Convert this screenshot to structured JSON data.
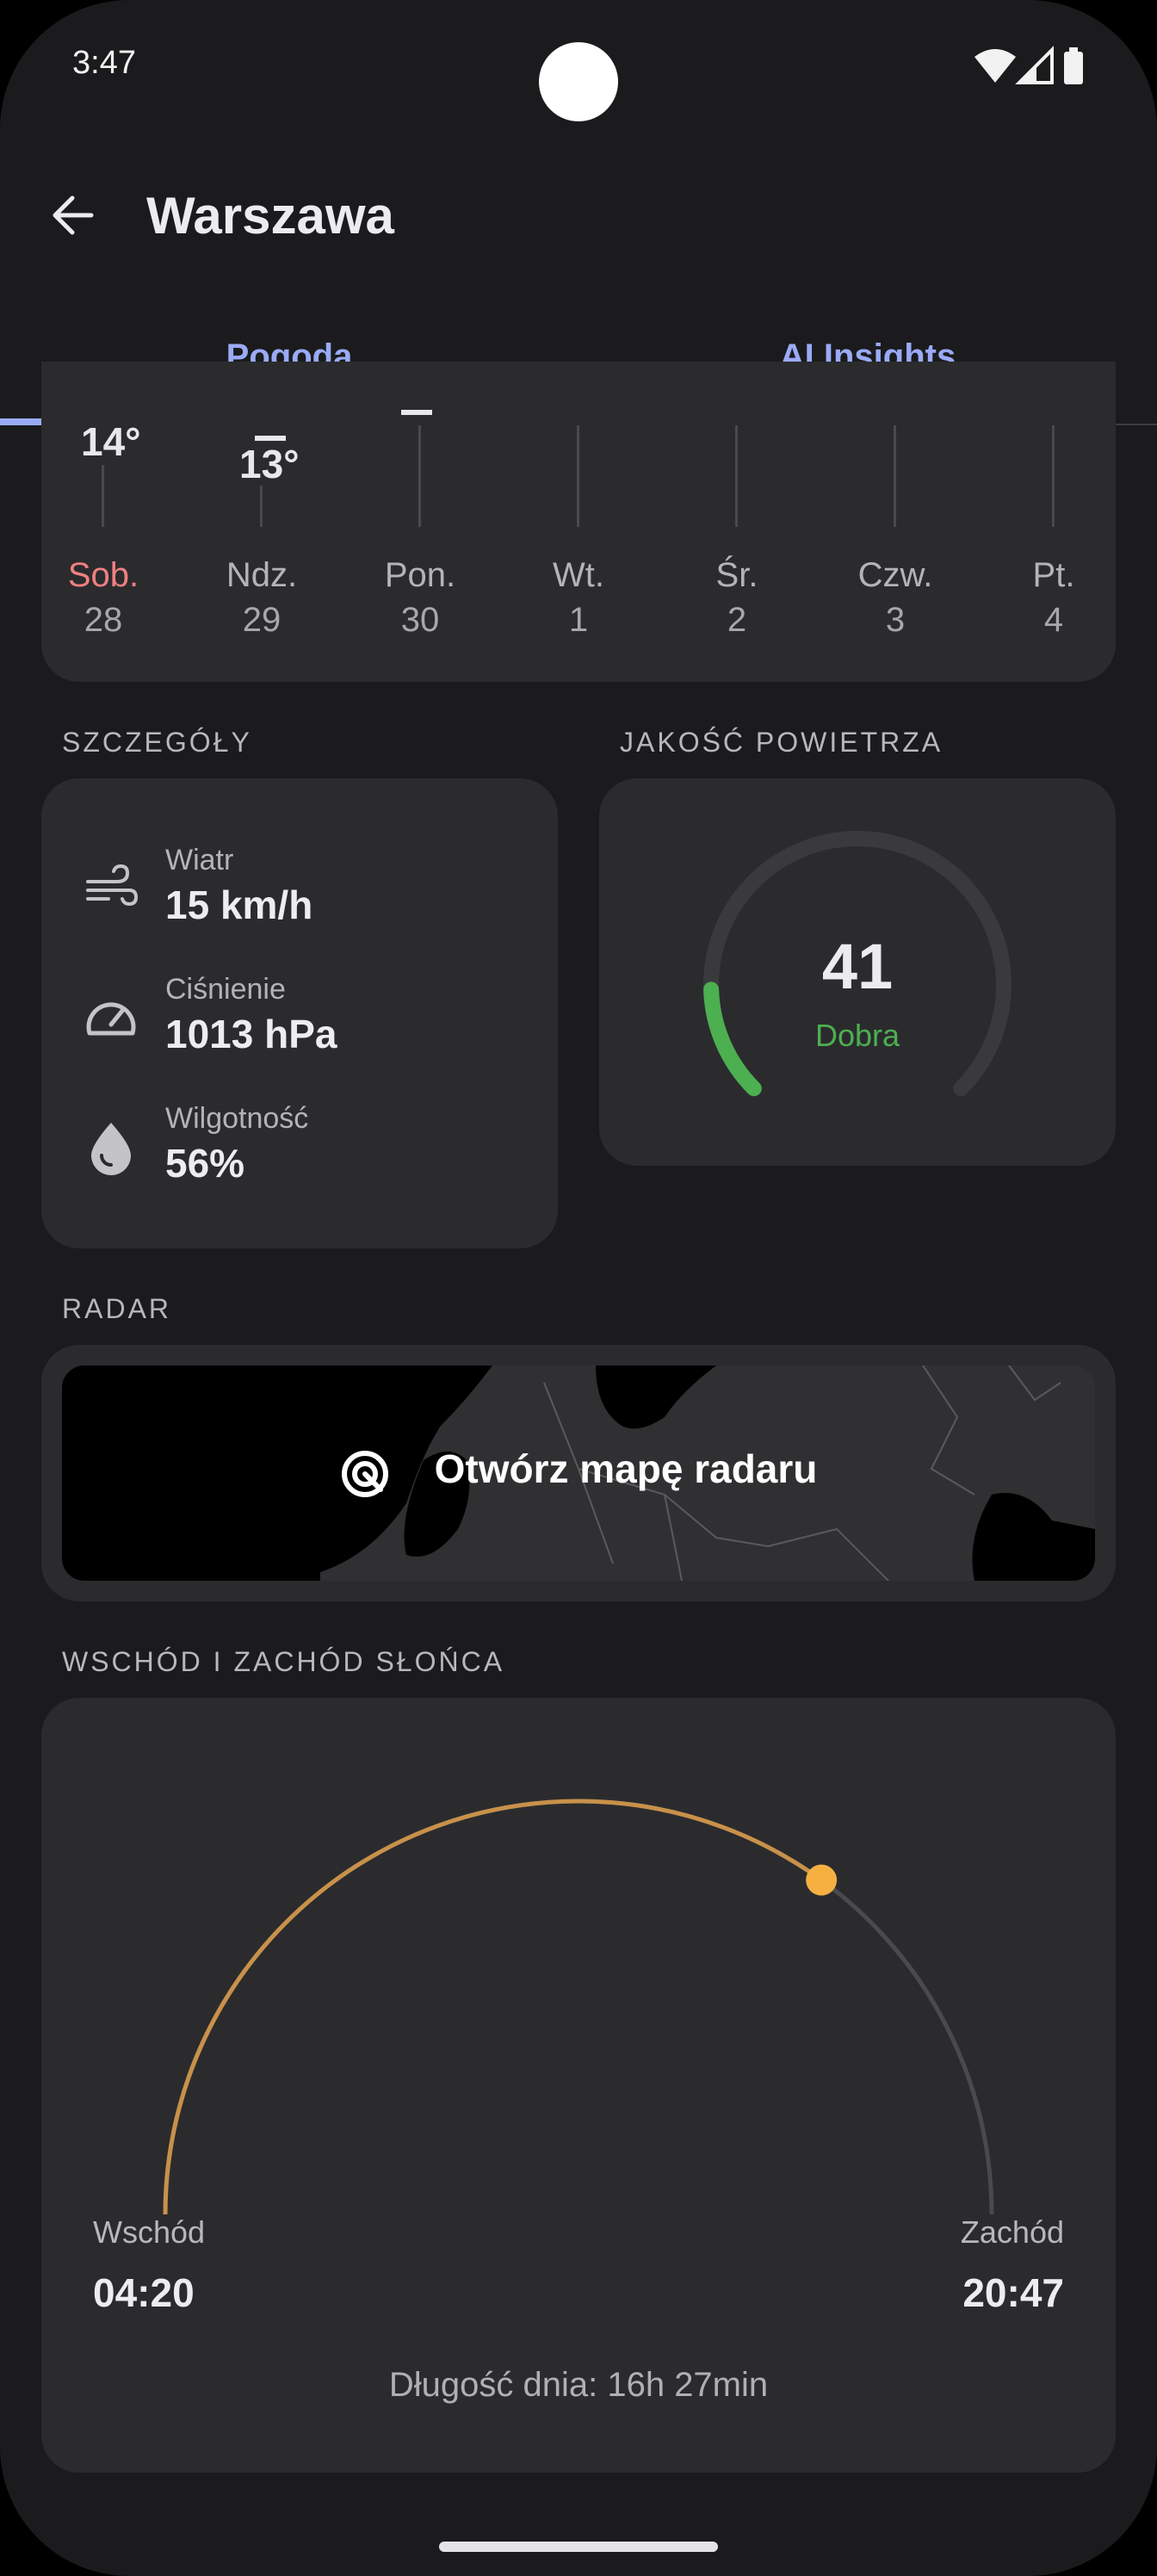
{
  "status_bar": {
    "time": "3:47",
    "icons": [
      "wifi-icon",
      "signal-icon",
      "battery-icon"
    ]
  },
  "header": {
    "title": "Warszawa"
  },
  "tabs": [
    {
      "label": "Pogoda",
      "selected": true
    },
    {
      "label": "AI Insights",
      "selected": false
    }
  ],
  "forecast": {
    "temps": [
      "14°",
      "13°"
    ],
    "days": [
      {
        "day": "Sob.",
        "date": "28",
        "highlight": true
      },
      {
        "day": "Ndz.",
        "date": "29"
      },
      {
        "day": "Pon.",
        "date": "30"
      },
      {
        "day": "Wt.",
        "date": "1"
      },
      {
        "day": "Śr.",
        "date": "2"
      },
      {
        "day": "Czw.",
        "date": "3"
      },
      {
        "day": "Pt.",
        "date": "4"
      }
    ]
  },
  "details": {
    "heading": "SZCZEGÓŁY",
    "items": [
      {
        "icon": "wind-icon",
        "label": "Wiatr",
        "value": "15 km/h"
      },
      {
        "icon": "gauge-icon",
        "label": "Ciśnienie",
        "value": "1013 hPa"
      },
      {
        "icon": "drop-icon",
        "label": "Wilgotność",
        "value": "56%"
      }
    ]
  },
  "air_quality": {
    "heading": "JAKOŚĆ POWIETRZA",
    "value": "41",
    "label": "Dobra",
    "fraction": 0.16,
    "color": "#4caf50"
  },
  "radar": {
    "heading": "RADAR",
    "button_label": "Otwórz mapę radaru"
  },
  "sun": {
    "heading": "WSCHÓD I ZACHÓD SŁOŃCA",
    "sunrise_label": "Wschód",
    "sunrise_time": "04:20",
    "sunset_label": "Zachód",
    "sunset_time": "20:47",
    "day_length": "Długość dnia: 16h 27min",
    "progress": 0.7,
    "arc_color": "#c8914a",
    "sun_color": "#f6b042"
  },
  "colors": {
    "accent": "#9aaaf7",
    "weekend": "#f08080"
  }
}
